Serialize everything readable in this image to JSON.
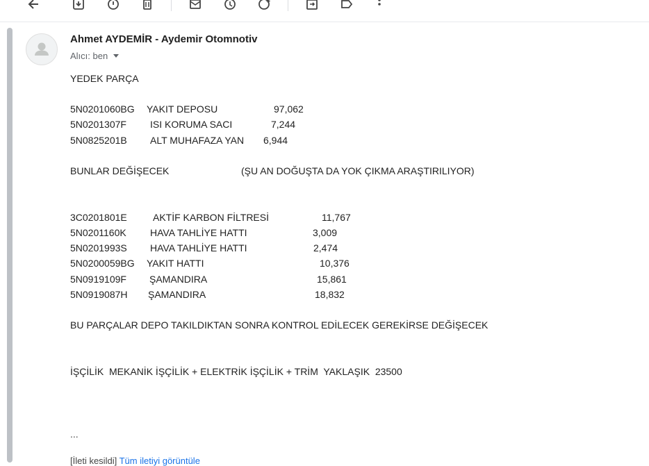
{
  "toolbar": {
    "icons": [
      "back-arrow-icon",
      "archive-icon",
      "report-spam-icon",
      "delete-icon",
      "mark-unread-icon",
      "snooze-icon",
      "add-task-icon",
      "move-to-icon",
      "label-icon",
      "more-icon"
    ]
  },
  "email": {
    "sender": "Ahmet AYDEMİR - Aydemir Otomnotiv",
    "recipient_label": "Alıcı: ben",
    "title": "YEDEK PARÇA",
    "group1": [
      {
        "code": "5N0201060BG",
        "name": "YAKIT DEPOSU",
        "price": "97,062"
      },
      {
        "code": "5N0201307F",
        "name": "ISI KORUMA SACI",
        "price": "7,244"
      },
      {
        "code": "5N0825201B",
        "name": "ALT MUHAFAZA YAN",
        "price": "6,944"
      }
    ],
    "note_left": "BUNLAR DEĞİŞECEK",
    "note_right": "(ŞU AN DOĞUŞTA DA YOK ÇIKMA ARAŞTIRILIYOR)",
    "group2": [
      {
        "code": "3C0201801E",
        "name": "AKTİF KARBON FİLTRESİ",
        "price": "11,767"
      },
      {
        "code": "5N0201160K",
        "name": "HAVA TAHLİYE HATTI",
        "price": "3,009"
      },
      {
        "code": "5N0201993S",
        "name": "HAVA TAHLİYE HATTI",
        "price": "2,474"
      },
      {
        "code": "5N0200059BG",
        "name": "YAKIT HATTI",
        "price": "10,376"
      },
      {
        "code": "5N0919109F",
        "name": "ŞAMANDIRA",
        "price": "15,861"
      },
      {
        "code": "5N0919087H",
        "name": "ŞAMANDIRA",
        "price": "18,832"
      }
    ],
    "control_note": "BU PARÇALAR DEPO TAKILDIKTAN SONRA KONTROL EDİLECEK GEREKİRSE DEĞİŞECEK",
    "labor_note": "İŞÇİLİK  MEKANİK İŞÇİLİK + ELEKTRİK İŞÇİLİK + TRİM  YAKLAŞIK  23500",
    "ellipsis": "...",
    "footer_prefix": "[İleti kesildi]",
    "footer_link": "Tüm iletiyi görüntüle"
  }
}
